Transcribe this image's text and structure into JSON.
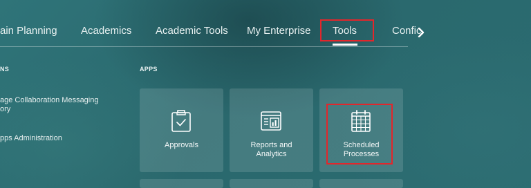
{
  "nav": {
    "items": [
      "ain Planning",
      "Academics",
      "Academic Tools",
      "My Enterprise",
      "Tools",
      "Confic"
    ],
    "active": "Tools",
    "next_icon": "chevron-right-icon"
  },
  "left": {
    "section_label": "NS",
    "items": [
      {
        "line1": "age Collaboration Messaging",
        "line2": "ory"
      },
      {
        "line1": "pps Administration",
        "line2": ""
      }
    ]
  },
  "apps": {
    "section_label": "APPS",
    "tiles": [
      {
        "label_line1": "Approvals",
        "label_line2": "",
        "icon": "clipboard-check-icon"
      },
      {
        "label_line1": "Reports and",
        "label_line2": "Analytics",
        "icon": "reports-chart-icon"
      },
      {
        "label_line1": "Scheduled",
        "label_line2": "Processes",
        "icon": "calendar-icon"
      }
    ]
  },
  "colors": {
    "background": "#2a6b70",
    "highlight": "#e3262b",
    "text": "#ffffff"
  }
}
